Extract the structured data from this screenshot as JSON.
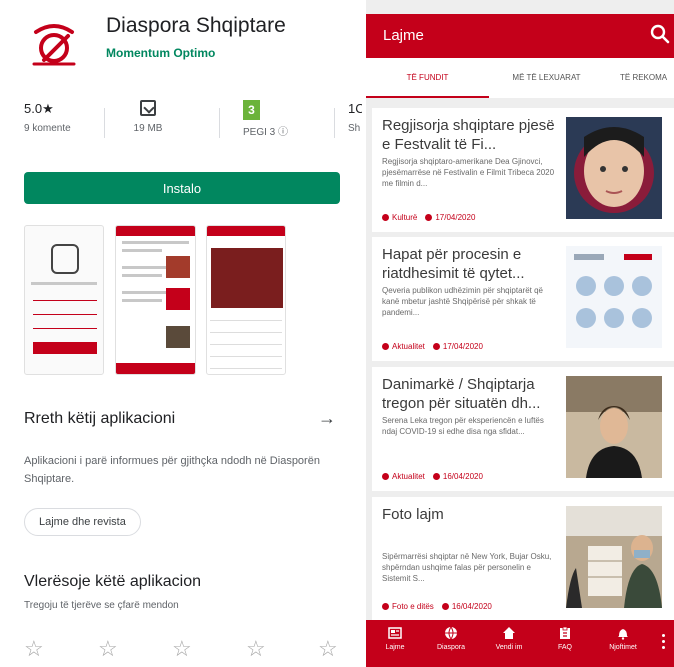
{
  "store": {
    "app_name": "Diaspora Shqiptare",
    "developer": "Momentum Optimo",
    "rating": "5.0★",
    "rating_count": "9 komente",
    "size": "19 MB",
    "pegi_badge": "3",
    "pegi_label": "PEGI 3 ⓘ",
    "fourth_stat": "1C",
    "fourth_sub": "Sh",
    "install_label": "Instalo",
    "about_title": "Rreth këtij aplikacioni",
    "about_arrow": "→",
    "about_text": "Aplikacioni i parë informues për gjithçka ndodh në Diasporën Shqiptare.",
    "category_chip": "Lajme dhe revista",
    "rate_title": "Vlerësoje këtë aplikacion",
    "rate_subtitle": "Tregoju të tjerëve se çfarë mendon",
    "stars": [
      "☆",
      "☆",
      "☆",
      "☆",
      "☆"
    ]
  },
  "app": {
    "header_title": "Lajme",
    "tabs": [
      "TË FUNDIT",
      "MË TË LEXUARAT",
      "TË REKOMA"
    ],
    "articles": [
      {
        "title": "Regjisorja shqiptare pjesë e Festvalit të Fi...",
        "excerpt": "Regjisorja shqiptaro-amerikane Dea Gjinovci, pjesëmarrëse në Festivalin e Filmit Tribeca 2020 me filmin d...",
        "category": "Kulturë",
        "date": "17/04/2020"
      },
      {
        "title": "Hapat për procesin e riatdhesimit të qytet...",
        "excerpt": "Qeveria publikon udhëzimin për shqiptarët që kanë mbetur jashtë Shqipërisë për shkak të pandemi...",
        "category": "Aktualitet",
        "date": "17/04/2020"
      },
      {
        "title": "Danimarkë / Shqiptarja tregon për situatën dh...",
        "excerpt": "Serena Leka tregon për eksperiencën e luftës ndaj COVID-19 si edhe disa nga sfidat...",
        "category": "Aktualitet",
        "date": "16/04/2020"
      },
      {
        "title": "Foto lajm",
        "excerpt": "Sipërmarrësi shqiptar në New York, Bujar Osku, shpërndan ushqime falas për personelin e Sistemit S...",
        "category": "Foto e ditës",
        "date": "16/04/2020"
      }
    ],
    "nav": [
      "Lajme",
      "Diaspora",
      "Vendi im",
      "FAQ",
      "Njoftimet"
    ]
  },
  "colors": {
    "brand_red": "#c4001a",
    "play_green": "#01875f"
  }
}
